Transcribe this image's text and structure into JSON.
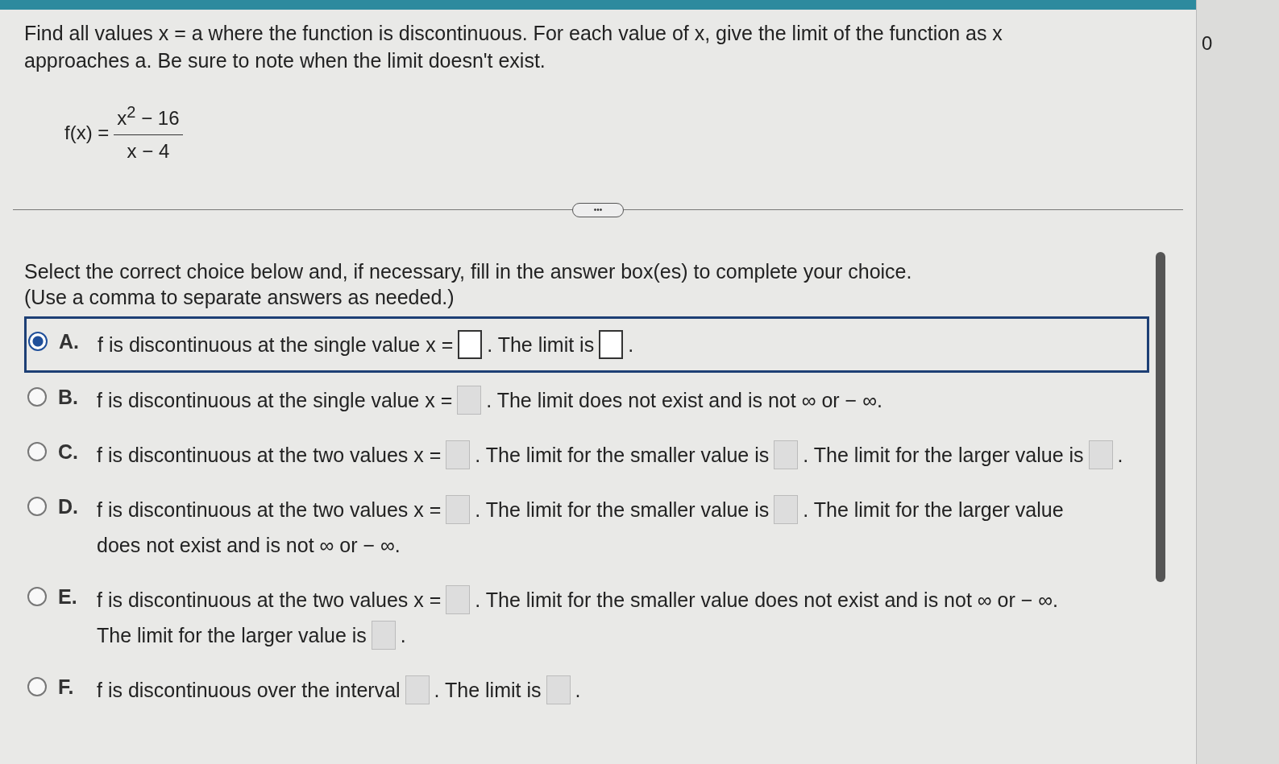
{
  "question": "Find all values x = a where the function is discontinuous. For each value of x, give the limit of the function as x approaches a. Be sure to note when the limit doesn't exist.",
  "formula": {
    "lhs": "f(x) =",
    "numerator": "x$^{2}$ − 16",
    "denominator": "x − 4"
  },
  "more_button": "•••",
  "side_text": "0",
  "instructions": [
    "Select the correct choice below and, if necessary, fill in the answer box(es) to complete your choice.",
    "(Use a comma to separate answers as needed.)"
  ],
  "choices": [
    {
      "letter": "A.",
      "selected": true,
      "parts": [
        {
          "kind": "text",
          "text": "f is discontinuous at the single value x ="
        },
        {
          "kind": "box"
        },
        {
          "kind": "text",
          "text": ". The limit is"
        },
        {
          "kind": "box"
        },
        {
          "kind": "text",
          "text": "."
        }
      ]
    },
    {
      "letter": "B.",
      "selected": false,
      "parts": [
        {
          "kind": "text",
          "text": "f is discontinuous at the single value x ="
        },
        {
          "kind": "box"
        },
        {
          "kind": "text",
          "text": ". The limit does not exist and is not ∞ or − ∞."
        }
      ]
    },
    {
      "letter": "C.",
      "selected": false,
      "parts": [
        {
          "kind": "text",
          "text": "f is discontinuous at the two values x ="
        },
        {
          "kind": "box"
        },
        {
          "kind": "text",
          "text": ". The limit for the smaller value is"
        },
        {
          "kind": "box"
        },
        {
          "kind": "text",
          "text": ". The limit for the larger value is"
        },
        {
          "kind": "box"
        },
        {
          "kind": "text",
          "text": "."
        }
      ]
    },
    {
      "letter": "D.",
      "selected": false,
      "parts": [
        {
          "kind": "text",
          "text": "f is discontinuous at the two values x ="
        },
        {
          "kind": "box"
        },
        {
          "kind": "text",
          "text": ". The limit for the smaller value is"
        },
        {
          "kind": "box"
        },
        {
          "kind": "text",
          "text": ". The limit for the larger value"
        },
        {
          "kind": "text",
          "text": "does not exist and is not ∞ or − ∞."
        }
      ]
    },
    {
      "letter": "E.",
      "selected": false,
      "parts": [
        {
          "kind": "text",
          "text": "f is discontinuous at the two values x ="
        },
        {
          "kind": "box"
        },
        {
          "kind": "text",
          "text": ". The limit for the smaller value does not exist and is not ∞ or − ∞."
        },
        {
          "kind": "text",
          "text": "The limit for the larger value is"
        },
        {
          "kind": "box"
        },
        {
          "kind": "text",
          "text": "."
        }
      ]
    },
    {
      "letter": "F.",
      "selected": false,
      "parts": [
        {
          "kind": "text",
          "text": "f is discontinuous over the interval"
        },
        {
          "kind": "box"
        },
        {
          "kind": "text",
          "text": ". The limit is"
        },
        {
          "kind": "box"
        },
        {
          "kind": "text",
          "text": "."
        }
      ]
    }
  ]
}
